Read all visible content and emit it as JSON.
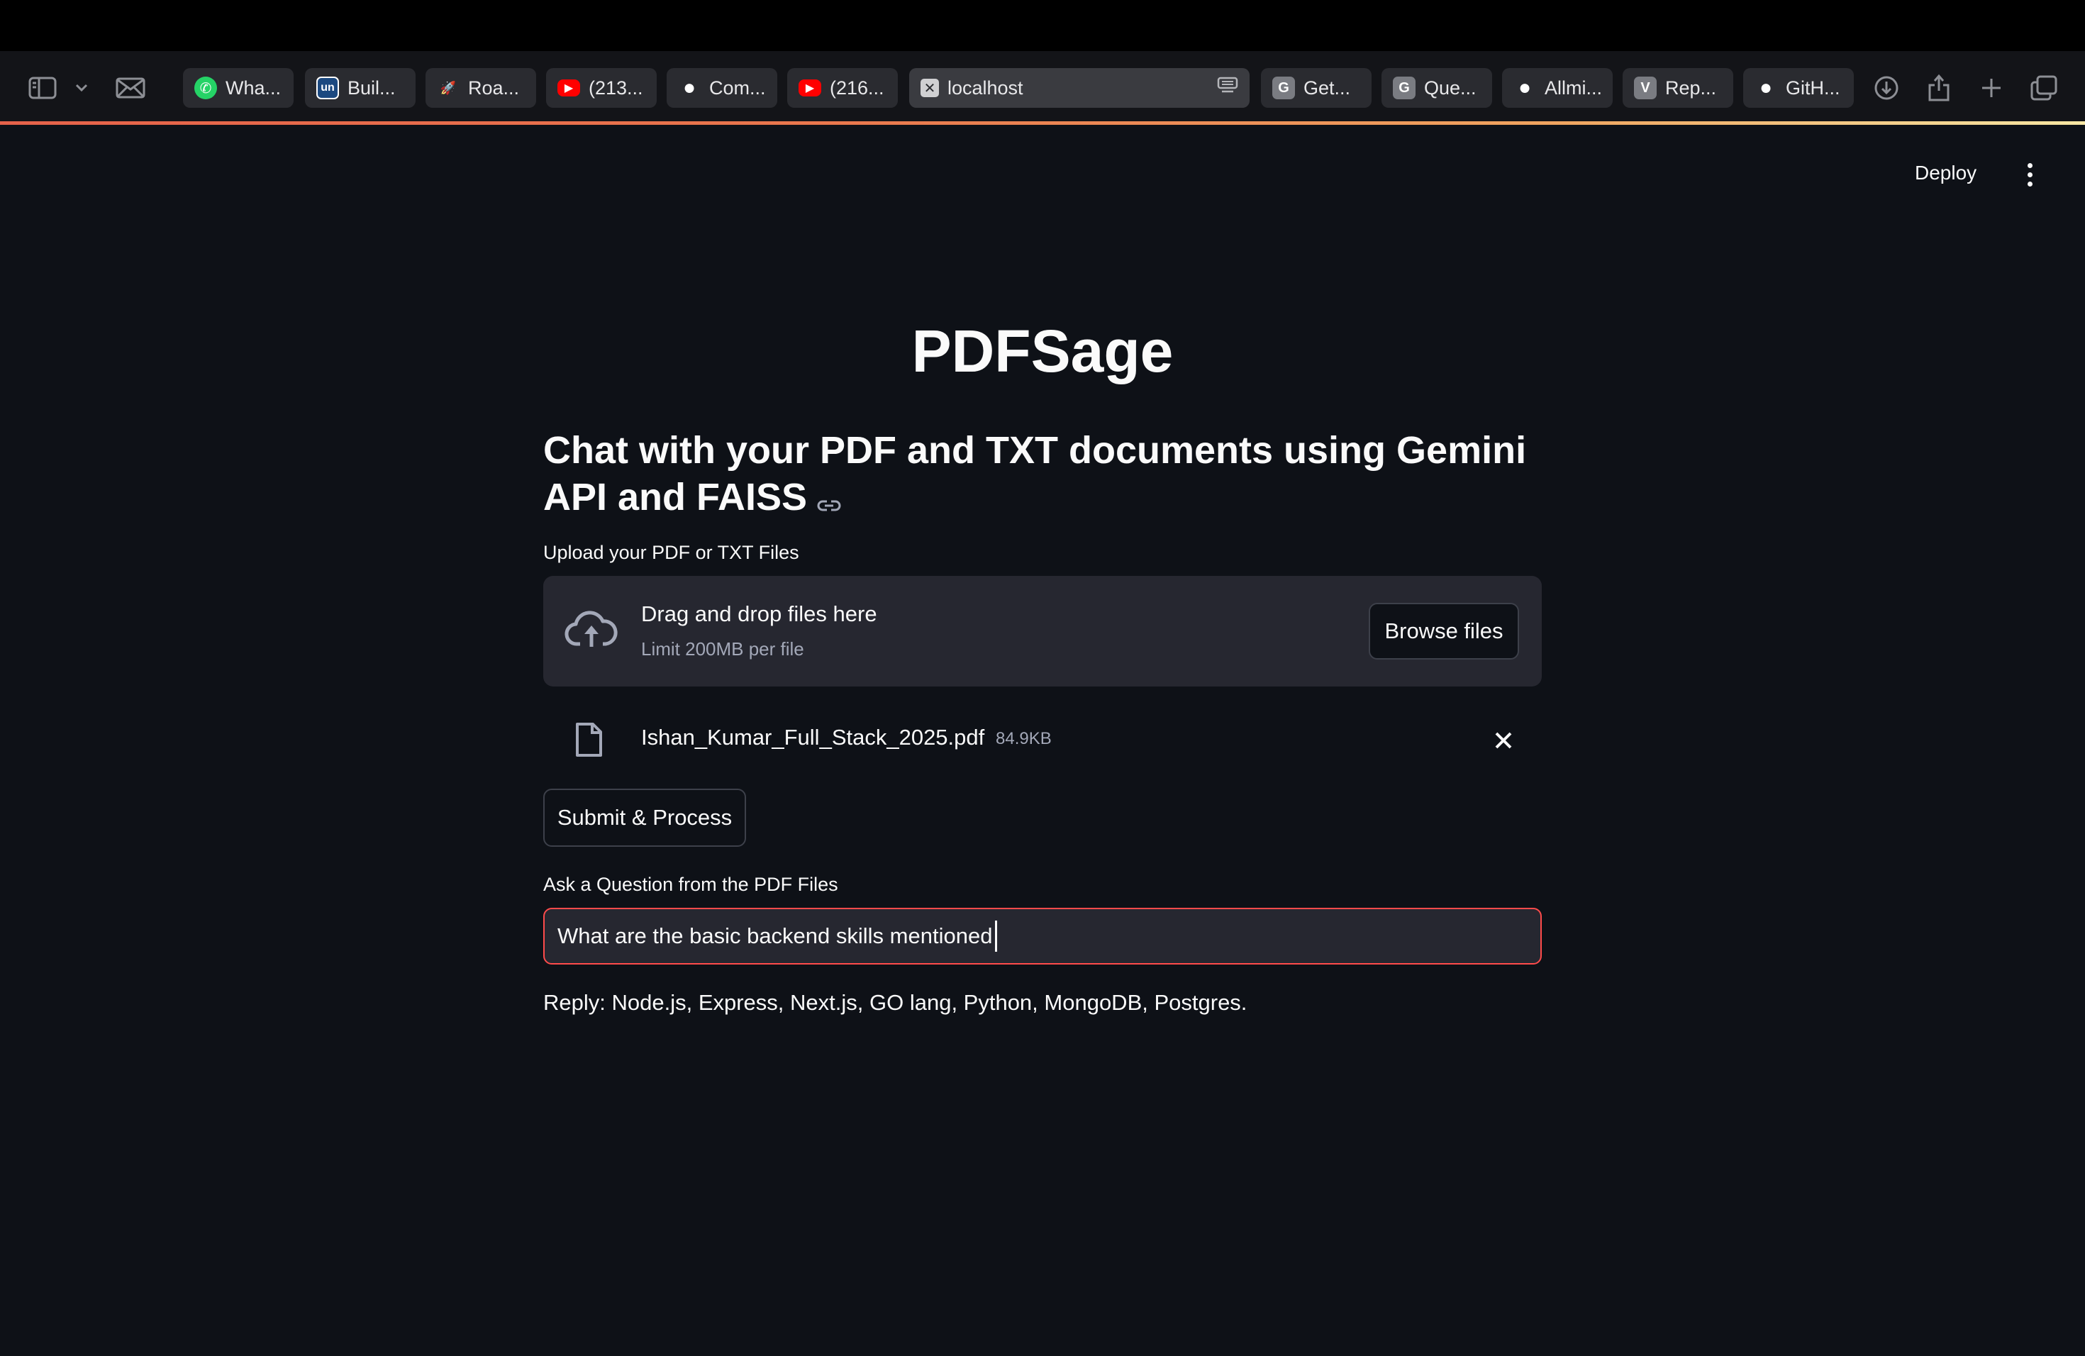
{
  "browser": {
    "tabs": [
      {
        "label": "Wha...",
        "icon": "whatsapp-icon",
        "color": "#25d366"
      },
      {
        "label": "Buil...",
        "icon": "unstop-icon",
        "color": "#1c4980"
      },
      {
        "label": "Roa...",
        "icon": "rocket-icon",
        "color": "#8a6cf0"
      },
      {
        "label": "(213...",
        "icon": "youtube-icon",
        "color": "#ff0000"
      },
      {
        "label": "Com...",
        "icon": "github-icon",
        "color": "#ffffff"
      },
      {
        "label": "(216...",
        "icon": "youtube-icon",
        "color": "#ff0000"
      },
      {
        "label": "localhost",
        "icon": "close-icon",
        "color": "#d0d0d2",
        "active": true
      },
      {
        "label": "Get...",
        "icon": "g-icon",
        "color": "#7a7c82"
      },
      {
        "label": "Que...",
        "icon": "g-icon",
        "color": "#7a7c82"
      },
      {
        "label": "Allmi...",
        "icon": "github-icon",
        "color": "#ffffff"
      },
      {
        "label": "Rep...",
        "icon": "v-icon",
        "color": "#7a7c82"
      },
      {
        "label": "GitH...",
        "icon": "github-icon",
        "color": "#ffffff"
      }
    ]
  },
  "header": {
    "deploy_label": "Deploy"
  },
  "app": {
    "title": "PDFSage",
    "subtitle": "Chat with your PDF and TXT documents using Gemini API and FAISS",
    "upload": {
      "label": "Upload your PDF or TXT Files",
      "drop_text": "Drag and drop files here",
      "limit_text": "Limit 200MB per file",
      "browse_label": "Browse files"
    },
    "file": {
      "name": "Ishan_Kumar_Full_Stack_2025.pdf",
      "size": "84.9KB"
    },
    "submit_label": "Submit & Process",
    "question": {
      "label": "Ask a Question from the PDF Files",
      "value": "What are the basic backend skills mentioned"
    },
    "reply": "Reply: Node.js, Express, Next.js, GO lang, Python, MongoDB, Postgres."
  },
  "colors": {
    "background": "#0e1117",
    "input_border_focus": "#ff4b4b",
    "panel": "#262730"
  }
}
